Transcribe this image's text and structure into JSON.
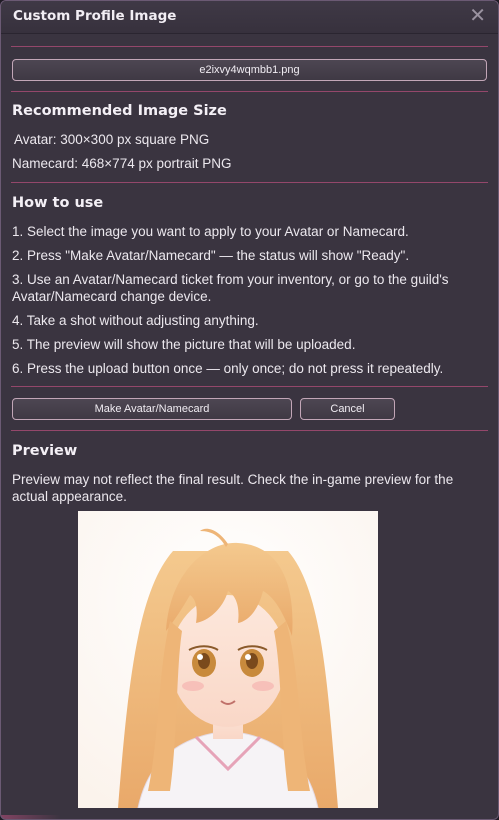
{
  "window": {
    "title": "Custom Profile Image",
    "close_label": "✕"
  },
  "file": {
    "name": "e2ixvy4wqmbb1.png"
  },
  "recommended": {
    "heading": "Recommended Image Size",
    "avatar": "Avatar: 300×300 px square PNG",
    "namecard": "Namecard: 468×774 px portrait PNG"
  },
  "how_to": {
    "heading": "How to use",
    "steps": [
      "1. Select the image you want to apply to your Avatar or Namecard.",
      "2. Press \"Make Avatar/Namecard\" — the status will show \"Ready\".",
      "3. Use an Avatar/Namecard ticket from your inventory, or go to the guild's Avatar/Namecard change device.",
      "4. Take a shot without adjusting anything.",
      "5. The preview will show the picture that will be uploaded.",
      "6. Press the upload button once — only once; do not press it repeatedly."
    ]
  },
  "actions": {
    "make_label": "Make Avatar/Namecard",
    "cancel_label": "Cancel"
  },
  "preview": {
    "heading": "Preview",
    "note": "Preview may not reflect the final result. Check the in-game preview for the actual appearance."
  },
  "colors": {
    "panel_bg": "#3a3440",
    "separator": "#b34e7a",
    "button_border": "#c2a6b7"
  }
}
